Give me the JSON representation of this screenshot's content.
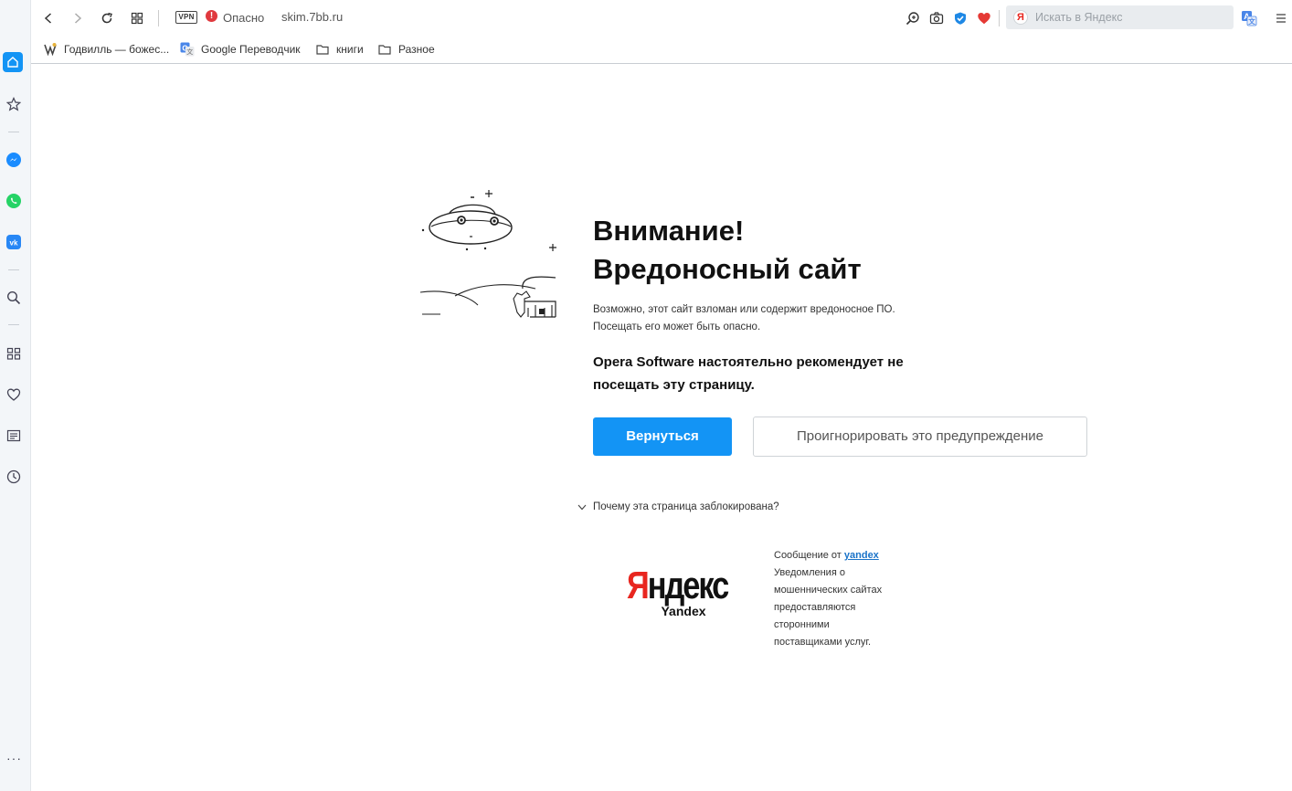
{
  "toolbar": {
    "vpn_label": "VPN",
    "security_label": "Опасно",
    "url": "skim.7bb.ru",
    "search_placeholder": "Искать в Яндекс",
    "search_badge": "Я",
    "colors": {
      "danger": "#e0393e",
      "heart": "#e53935",
      "shield": "#1e88e5"
    }
  },
  "bookmarks": [
    {
      "label": "Годвилль — божес...",
      "icon": "godville-icon"
    },
    {
      "label": "Google Переводчик",
      "icon": "google-translate-icon"
    },
    {
      "label": "книги",
      "icon": "folder-icon"
    },
    {
      "label": "Разное",
      "icon": "folder-icon"
    }
  ],
  "sidebar": {
    "items": [
      "home-icon",
      "star-icon",
      "messenger-icon",
      "whatsapp-icon",
      "vk-icon",
      "search-icon",
      "grid-icon",
      "heart-icon",
      "news-icon",
      "history-icon"
    ],
    "active_color": "#1394f5",
    "more_label": "···"
  },
  "warning": {
    "title_line1": "Внимание!",
    "title_line2": "Вредоносный сайт",
    "desc_line1": "Возможно, этот сайт взломан или содержит вредоносное ПО.",
    "desc_line2": "Посещать его может быть опасно.",
    "recommend_line1": "Opera Software настоятельно рекомендует не",
    "recommend_line2": "посещать эту страницу.",
    "back_button": "Вернуться",
    "ignore_button": "Проигнорировать это предупреждение",
    "why_link": "Почему эта страница заблокирована?",
    "accent_color": "#1394f5"
  },
  "source": {
    "logo_text_first": "Я",
    "logo_text_rest": "ндекс",
    "logo_sub": "Yandex",
    "message_prefix": "Сообщение от ",
    "message_link": "yandex",
    "line2": "Уведомления о",
    "line3": "мошеннических сайтах",
    "line4": "предоставляются",
    "line5": "сторонними",
    "line6": "поставщиками услуг."
  }
}
